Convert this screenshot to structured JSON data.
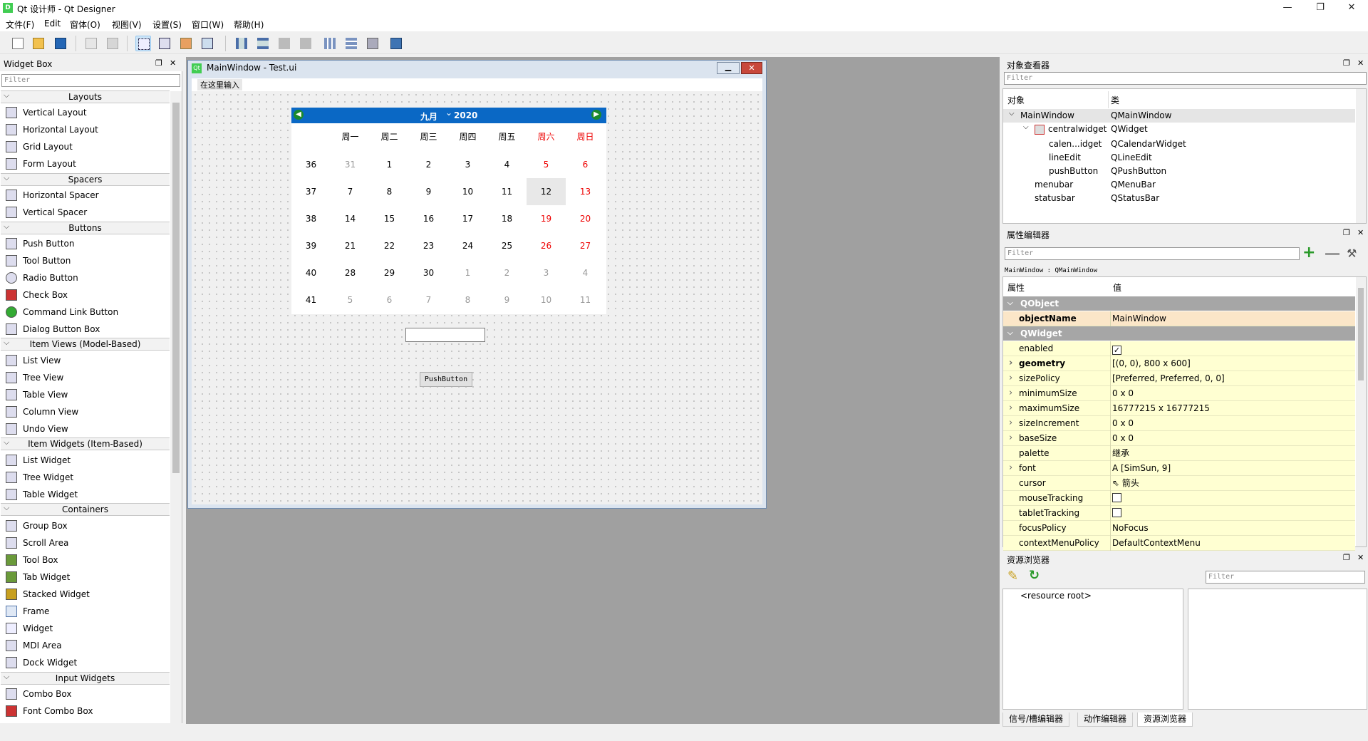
{
  "window": {
    "title": "Qt 设计师 - Qt Designer",
    "app_icon": "D",
    "min": "—",
    "max": "❐",
    "close": "✕"
  },
  "menu": [
    "文件(F)",
    "Edit",
    "窗体(O)",
    "视图(V)",
    "设置(S)",
    "窗口(W)",
    "帮助(H)"
  ],
  "widget_box": {
    "title": "Widget Box",
    "filter": "Filter",
    "categories": {
      "layouts": {
        "label": "Layouts",
        "items": [
          "Vertical Layout",
          "Horizontal Layout",
          "Grid Layout",
          "Form Layout"
        ]
      },
      "spacers": {
        "label": "Spacers",
        "items": [
          "Horizontal Spacer",
          "Vertical Spacer"
        ]
      },
      "buttons": {
        "label": "Buttons",
        "items": [
          "Push Button",
          "Tool Button",
          "Radio Button",
          "Check Box",
          "Command Link Button",
          "Dialog Button Box"
        ]
      },
      "item_views": {
        "label": "Item Views (Model-Based)",
        "items": [
          "List View",
          "Tree View",
          "Table View",
          "Column View",
          "Undo View"
        ]
      },
      "item_widgets": {
        "label": "Item Widgets (Item-Based)",
        "items": [
          "List Widget",
          "Tree Widget",
          "Table Widget"
        ]
      },
      "containers": {
        "label": "Containers",
        "items": [
          "Group Box",
          "Scroll Area",
          "Tool Box",
          "Tab Widget",
          "Stacked Widget",
          "Frame",
          "Widget",
          "MDI Area",
          "Dock Widget"
        ]
      },
      "input": {
        "label": "Input Widgets",
        "items": [
          "Combo Box",
          "Font Combo Box"
        ]
      }
    }
  },
  "form": {
    "title": "MainWindow - Test.ui",
    "icon": "Qt",
    "menu_placeholder": "在这里输入",
    "calendar": {
      "month": "九月",
      "year": "2020",
      "headers": [
        "周一",
        "周二",
        "周三",
        "周四",
        "周五",
        "周六",
        "周日"
      ],
      "weeks": [
        "36",
        "37",
        "38",
        "39",
        "40",
        "41"
      ],
      "days": [
        [
          "31",
          "1",
          "2",
          "3",
          "4",
          "5",
          "6"
        ],
        [
          "7",
          "8",
          "9",
          "10",
          "11",
          "12",
          "13"
        ],
        [
          "14",
          "15",
          "16",
          "17",
          "18",
          "19",
          "20"
        ],
        [
          "21",
          "22",
          "23",
          "24",
          "25",
          "26",
          "27"
        ],
        [
          "28",
          "29",
          "30",
          "1",
          "2",
          "3",
          "4"
        ],
        [
          "5",
          "6",
          "7",
          "8",
          "9",
          "10",
          "11"
        ]
      ],
      "selected_day": "12"
    },
    "push_button": "PushButton"
  },
  "object_inspector": {
    "title": "对象查看器",
    "filter": "Filter",
    "col_object": "对象",
    "col_class": "类",
    "rows": [
      {
        "name": "MainWindow",
        "cls": "QMainWindow"
      },
      {
        "name": "centralwidget",
        "cls": "QWidget"
      },
      {
        "name": "calen...idget",
        "cls": "QCalendarWidget"
      },
      {
        "name": "lineEdit",
        "cls": "QLineEdit"
      },
      {
        "name": "pushButton",
        "cls": "QPushButton"
      },
      {
        "name": "menubar",
        "cls": "QMenuBar"
      },
      {
        "name": "statusbar",
        "cls": "QStatusBar"
      }
    ]
  },
  "property_editor": {
    "title": "属性编辑器",
    "filter": "Filter",
    "context": "MainWindow : QMainWindow",
    "col_prop": "属性",
    "col_value": "值",
    "group_qobject": "QObject",
    "objectName_key": "objectName",
    "objectName_val": "MainWindow",
    "group_qwidget": "QWidget",
    "props": [
      {
        "k": "enabled",
        "v": "✓"
      },
      {
        "k": "geometry",
        "v": "[(0, 0), 800 x 600]"
      },
      {
        "k": "sizePolicy",
        "v": "[Preferred, Preferred, 0, 0]"
      },
      {
        "k": "minimumSize",
        "v": "0 x 0"
      },
      {
        "k": "maximumSize",
        "v": "16777215 x 16777215"
      },
      {
        "k": "sizeIncrement",
        "v": "0 x 0"
      },
      {
        "k": "baseSize",
        "v": "0 x 0"
      },
      {
        "k": "palette",
        "v": "继承"
      },
      {
        "k": "font",
        "v": "[SimSun, 9]"
      },
      {
        "k": "cursor",
        "v": "箭头"
      },
      {
        "k": "mouseTracking",
        "v": ""
      },
      {
        "k": "tabletTracking",
        "v": ""
      },
      {
        "k": "focusPolicy",
        "v": "NoFocus"
      },
      {
        "k": "contextMenuPolicy",
        "v": "DefaultContextMenu"
      }
    ]
  },
  "resource_browser": {
    "title": "资源浏览器",
    "filter": "Filter",
    "root": "<resource root>"
  },
  "bottom_tabs": [
    "信号/槽编辑器",
    "动作编辑器",
    "资源浏览器"
  ]
}
